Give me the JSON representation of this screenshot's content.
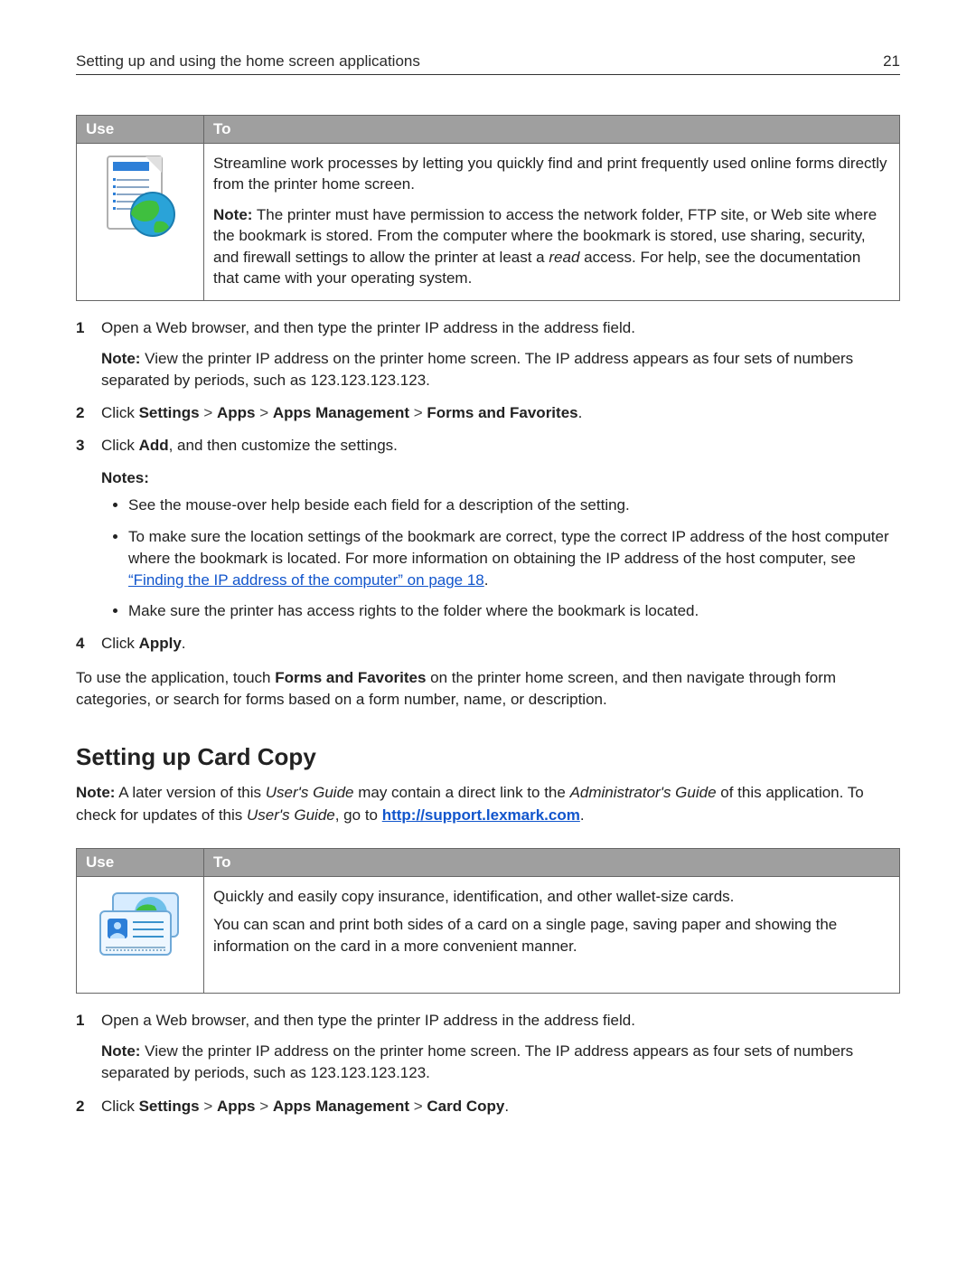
{
  "header": {
    "title": "Setting up and using the home screen applications",
    "page": "21"
  },
  "table1": {
    "h_use": "Use",
    "h_to": "To",
    "p1": "Streamline work processes by letting you quickly find and print frequently used online forms directly from the printer home screen.",
    "note_label": "Note:",
    "note_a": " The printer must have permission to access the network folder, FTP site, or Web site where the bookmark is stored. From the computer where the bookmark is stored, use sharing, security, and firewall settings to allow the printer at least a ",
    "note_read": "read",
    "note_b": " access. For help, see the documentation that came with your operating system."
  },
  "steps1": {
    "s1": "Open a Web browser, and then type the printer IP address in the address field.",
    "s1_note_label": "Note:",
    "s1_note": " View the printer IP address on the printer home screen. The IP address appears as four sets of numbers separated by periods, such as 123.123.123.123.",
    "s2_a": "Click ",
    "s2_b1": "Settings",
    "s2_gt": " > ",
    "s2_b2": "Apps",
    "s2_b3": "Apps Management",
    "s2_b4": "Forms and Favorites",
    "s2_dot": ".",
    "s3_a": "Click ",
    "s3_b": "Add",
    "s3_c": ", and then customize the settings.",
    "notes_label": "Notes:",
    "bul1": "See the mouse-over help beside each field for a description of the setting.",
    "bul2_a": "To make sure the location settings of the bookmark are correct, type the correct IP address of the host computer where the bookmark is located. For more information on obtaining the IP address of the host computer, see ",
    "bul2_link": "“Finding the IP address of the computer” on page 18",
    "bul2_b": ".",
    "bul3": "Make sure the printer has access rights to the folder where the bookmark is located.",
    "s4_a": "Click ",
    "s4_b": "Apply",
    "s4_c": "."
  },
  "para1_a": "To use the application, touch ",
  "para1_b": "Forms and Favorites",
  "para1_c": " on the printer home screen, and then navigate through form categories, or search for forms based on a form number, name, or description.",
  "h2": "Setting up Card Copy",
  "para2_nl": "Note:",
  "para2_a": " A later version of this ",
  "para2_i1": "User's Guide",
  "para2_b": " may contain a direct link to the ",
  "para2_i2": "Administrator's Guide",
  "para2_c": " of this application. To check for updates of this ",
  "para2_i3": "User's Guide",
  "para2_d": ", go to ",
  "para2_link": "http://support.lexmark.com",
  "para2_e": ".",
  "table2": {
    "h_use": "Use",
    "h_to": "To",
    "p1": "Quickly and easily copy insurance, identification, and other wallet-size cards.",
    "p2": "You can scan and print both sides of a card on a single page, saving paper and showing the information on the card in a more convenient manner."
  },
  "steps2": {
    "s1": "Open a Web browser, and then type the printer IP address in the address field.",
    "s1_note_label": "Note:",
    "s1_note": " View the printer IP address on the printer home screen. The IP address appears as four sets of numbers separated by periods, such as 123.123.123.123.",
    "s2_a": "Click ",
    "s2_b1": "Settings",
    "s2_gt": " > ",
    "s2_b2": "Apps",
    "s2_b3": "Apps Management",
    "s2_b4": "Card Copy",
    "s2_dot": "."
  }
}
